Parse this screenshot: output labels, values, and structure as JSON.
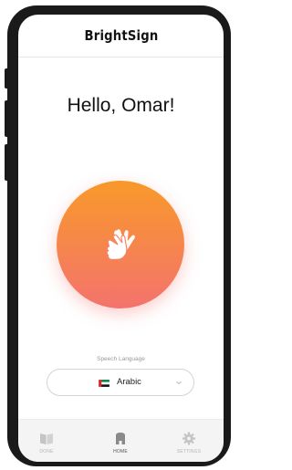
{
  "app": {
    "title": "BrightSign"
  },
  "main": {
    "greeting": "Hello, Omar!",
    "sign_button_icon": "hands-icon",
    "accent_gradient": [
      "#f8992a",
      "#f4736d"
    ]
  },
  "language": {
    "label": "Speech Language",
    "selected": "Arabic",
    "flag_icon": "uae-flag-icon"
  },
  "tabbar": {
    "items": [
      {
        "label": "DONE",
        "icon": "book-icon",
        "active": false
      },
      {
        "label": "HOME",
        "icon": "home-icon",
        "active": true
      },
      {
        "label": "SETTINGS",
        "icon": "gear-icon",
        "active": false
      }
    ]
  }
}
